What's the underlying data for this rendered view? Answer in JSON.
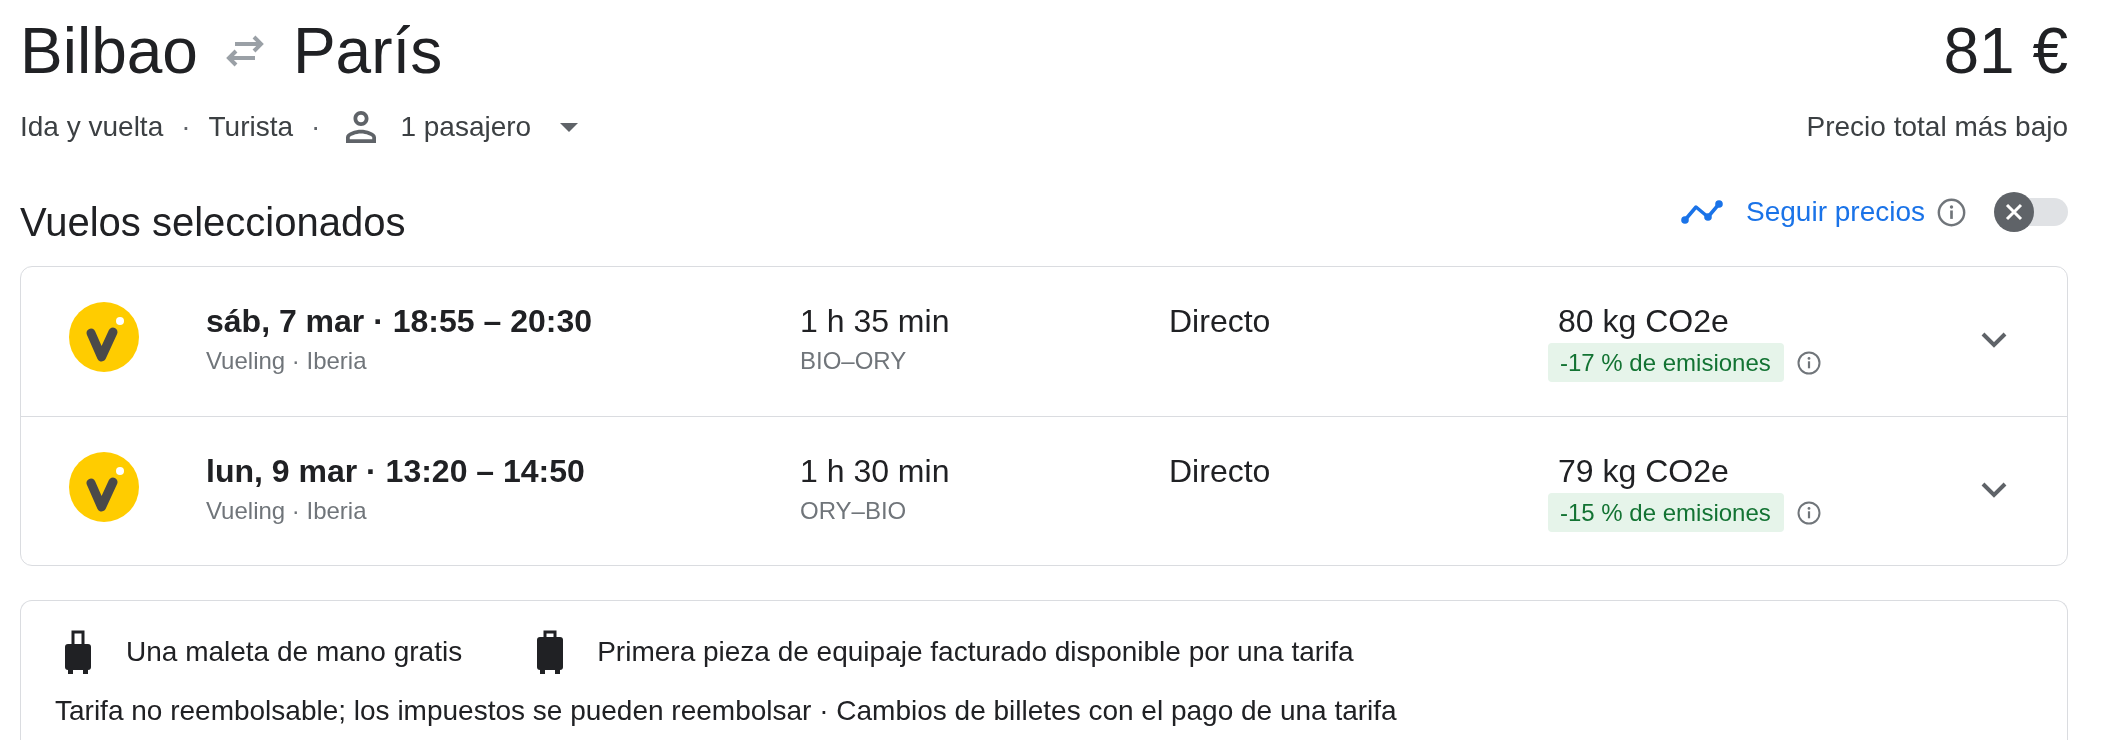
{
  "header": {
    "origin": "Bilbao",
    "destination": "París",
    "price": "81 €",
    "price_caption": "Precio total más bajo"
  },
  "summary": [
    {
      "kind": "text",
      "label": "Ida y vuelta"
    },
    {
      "kind": "separator",
      "label": "·"
    },
    {
      "kind": "text",
      "label": "Turista"
    },
    {
      "kind": "separator",
      "label": "·"
    },
    {
      "kind": "passengers",
      "label": "1 pasajero"
    }
  ],
  "section": {
    "title": "Vuelos seleccionados"
  },
  "price_tracking": {
    "label": "Seguir precios",
    "on": false
  },
  "flights": [
    {
      "date_time": "sáb, 7 mar · 18:55 – 20:30",
      "airlines": "Vueling · Iberia",
      "duration": "1 h 35 min",
      "route": "BIO–ORY",
      "stops": "Directo",
      "emissions": "80 kg CO2e",
      "emissions_delta": "-17 % de emisiones",
      "expanded": false
    },
    {
      "date_time": "lun, 9 mar · 13:20 – 14:50",
      "airlines": "Vueling · Iberia",
      "duration": "1 h 30 min",
      "route": "ORY–BIO",
      "stops": "Directo",
      "emissions": "79 kg CO2e",
      "emissions_delta": "-15 % de emisiones",
      "expanded": false
    }
  ],
  "fare_details": {
    "baggage": [
      {
        "kind": "carry_on",
        "label": "Una maleta de mano gratis"
      },
      {
        "kind": "checked",
        "label": "Primera pieza de equipaje facturado disponible por una tarifa"
      }
    ],
    "conditions": "Tarifa no reembolsable; los impuestos se pueden reembolsar · Cambios de billetes con el pago de una tarifa"
  }
}
